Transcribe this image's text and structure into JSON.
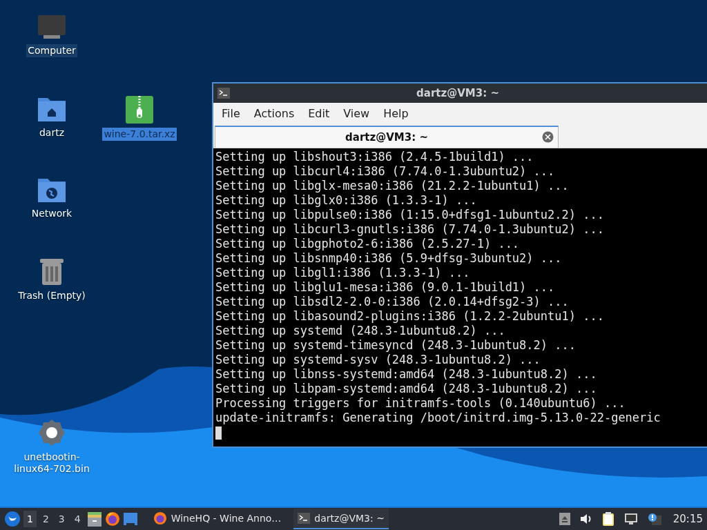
{
  "desktop_icons": [
    {
      "label": "Computer",
      "kind": "computer",
      "selected": false,
      "focused": true
    },
    {
      "label": "dartz",
      "kind": "home",
      "selected": false,
      "focused": false
    },
    {
      "label": "wine-7.0.tar.xz",
      "kind": "archive",
      "selected": true,
      "focused": false
    },
    {
      "label": "Network",
      "kind": "network",
      "selected": false,
      "focused": false
    },
    {
      "label": "Trash (Empty)",
      "kind": "trash",
      "selected": false,
      "focused": false
    },
    {
      "label": "unetbootin-\nlinux64-702.bin",
      "kind": "executable",
      "selected": false,
      "focused": false
    }
  ],
  "terminal_window": {
    "title": "dartz@VM3: ~",
    "menu": [
      "File",
      "Actions",
      "Edit",
      "View",
      "Help"
    ],
    "tabs": [
      {
        "label": "dartz@VM3: ~",
        "selected": true
      }
    ],
    "lines": [
      "Setting up libshout3:i386 (2.4.5-1build1) ...",
      "Setting up libcurl4:i386 (7.74.0-1.3ubuntu2) ...",
      "Setting up libglx-mesa0:i386 (21.2.2-1ubuntu1) ...",
      "Setting up libglx0:i386 (1.3.3-1) ...",
      "Setting up libpulse0:i386 (1:15.0+dfsg1-1ubuntu2.2) ...",
      "Setting up libcurl3-gnutls:i386 (7.74.0-1.3ubuntu2) ...",
      "Setting up libgphoto2-6:i386 (2.5.27-1) ...",
      "Setting up libsnmp40:i386 (5.9+dfsg-3ubuntu2) ...",
      "Setting up libgl1:i386 (1.3.3-1) ...",
      "Setting up libglu1-mesa:i386 (9.0.1-1build1) ...",
      "Setting up libsdl2-2.0-0:i386 (2.0.14+dfsg2-3) ...",
      "Setting up libasound2-plugins:i386 (1.2.2-2ubuntu1) ...",
      "Setting up systemd (248.3-1ubuntu8.2) ...",
      "Setting up systemd-timesyncd (248.3-1ubuntu8.2) ...",
      "Setting up systemd-sysv (248.3-1ubuntu8.2) ...",
      "Setting up libnss-systemd:amd64 (248.3-1ubuntu8.2) ...",
      "Setting up libpam-systemd:amd64 (248.3-1ubuntu8.2) ...",
      "Processing triggers for initramfs-tools (0.140ubuntu6) ...",
      "update-initramfs: Generating /boot/initrd.img-5.13.0-22-generic"
    ]
  },
  "taskbar": {
    "workspaces": [
      {
        "label": "1",
        "selected": true
      },
      {
        "label": "2",
        "selected": false
      },
      {
        "label": "3",
        "selected": false
      },
      {
        "label": "4",
        "selected": false
      }
    ],
    "launchers": [
      {
        "kind": "files"
      },
      {
        "kind": "firefox"
      },
      {
        "kind": "desktop"
      }
    ],
    "tasks": [
      {
        "label": "WineHQ - Wine Anno…",
        "kind": "firefox",
        "selected": false
      },
      {
        "label": "dartz@VM3: ~",
        "kind": "terminal",
        "selected": true
      }
    ],
    "tray": [
      {
        "kind": "eject"
      },
      {
        "kind": "volume"
      },
      {
        "kind": "clipboard"
      },
      {
        "kind": "network"
      },
      {
        "kind": "notification"
      }
    ],
    "clock": "20:15"
  }
}
